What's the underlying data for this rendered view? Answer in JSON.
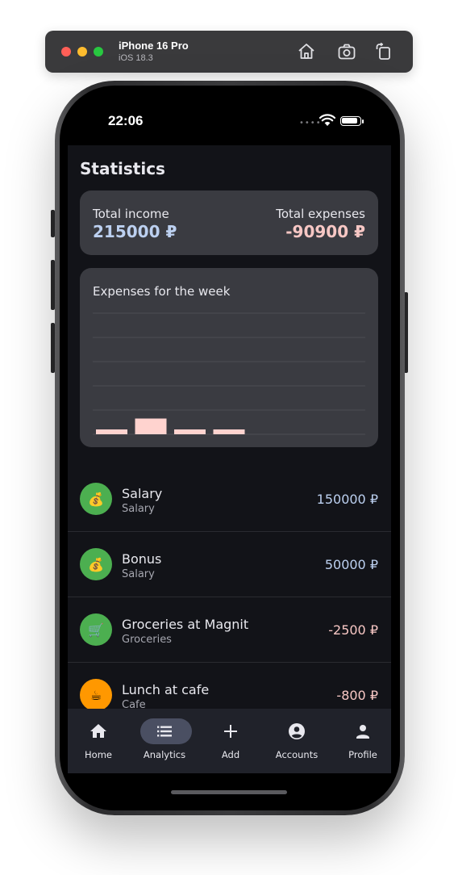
{
  "simulator": {
    "device_name": "iPhone 16 Pro",
    "os_version": "iOS 18.3"
  },
  "status_bar": {
    "time": "22:06"
  },
  "page": {
    "title": "Statistics"
  },
  "totals": {
    "income_label": "Total income",
    "income_value": "215000 ₽",
    "expenses_label": "Total expenses",
    "expenses_value": "-90900 ₽"
  },
  "chart": {
    "title": "Expenses for the week"
  },
  "chart_data": {
    "type": "bar",
    "title": "Expenses for the week",
    "values": [
      400,
      1300,
      400,
      400,
      0,
      0,
      0
    ],
    "ylim": [
      0,
      10000
    ],
    "grid": true,
    "bar_color": "#ffd3cf"
  },
  "transactions": [
    {
      "name": "Salary",
      "category": "Salary",
      "amount": "150000 ₽",
      "type": "income",
      "icon": "money-bag-icon",
      "glyph": "💰",
      "avatar_color": "#4caf50"
    },
    {
      "name": "Bonus",
      "category": "Salary",
      "amount": "50000 ₽",
      "type": "income",
      "icon": "money-bag-icon",
      "glyph": "💰",
      "avatar_color": "#4caf50"
    },
    {
      "name": "Groceries at Magnit",
      "category": "Groceries",
      "amount": "-2500 ₽",
      "type": "expense",
      "icon": "shopping-cart-icon",
      "glyph": "🛒",
      "avatar_color": "#4caf50"
    },
    {
      "name": "Lunch at cafe",
      "category": "Cafe",
      "amount": "-800 ₽",
      "type": "expense",
      "icon": "coffee-icon",
      "glyph": "☕",
      "avatar_color": "#ff9800"
    }
  ],
  "nav": [
    {
      "label": "Home",
      "icon": "home-icon",
      "active": false
    },
    {
      "label": "Analytics",
      "icon": "list-icon",
      "active": true
    },
    {
      "label": "Add",
      "icon": "plus-icon",
      "active": false
    },
    {
      "label": "Accounts",
      "icon": "account-circle-icon",
      "active": false
    },
    {
      "label": "Profile",
      "icon": "person-icon",
      "active": false
    }
  ],
  "colors": {
    "income": "#bcd0f0",
    "expense": "#f7c7c4",
    "nav_active_pill": "#4a4f62",
    "background": "#121318"
  }
}
